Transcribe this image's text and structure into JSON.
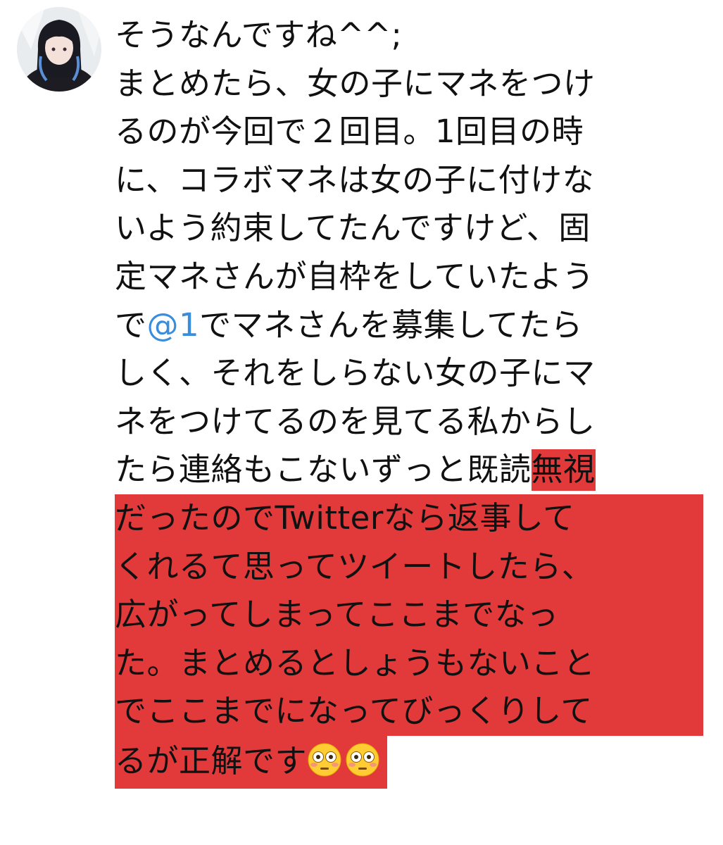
{
  "tweet": {
    "lines": {
      "l1": "そうなんですね^^;",
      "l2": "まとめたら、女の子にマネをつけ",
      "l3": "るのが今回で２回目。1回目の時",
      "l4": "に、コラボマネは女の子に付けな",
      "l5": "いよう約束してたんですけど、固",
      "l6": "定マネさんが自枠をしていたよう",
      "l7_pre": "で",
      "l7_mention": "@1",
      "l7_post": "でマネさんを募集してたら",
      "l8": "しく、それをしらない女の子にマ",
      "l9": "ネをつけてるのを見てる私からし",
      "l10_plain": "たら連絡もこないずっと既読",
      "l10_hl": "無視",
      "l11": "だったのでTwitterなら返事して",
      "l12": "くれるて思ってツイートしたら、",
      "l13": "広がってしまってここまでなっ",
      "l14": "た。まとめるとしょうもないこと",
      "l15": "でここまでになってびっくりして",
      "l16": "るが正解です"
    },
    "emoji_name": "flushed-face-icon",
    "highlight_color": "#e23a3a",
    "mention_color": "#3a8ddb"
  }
}
